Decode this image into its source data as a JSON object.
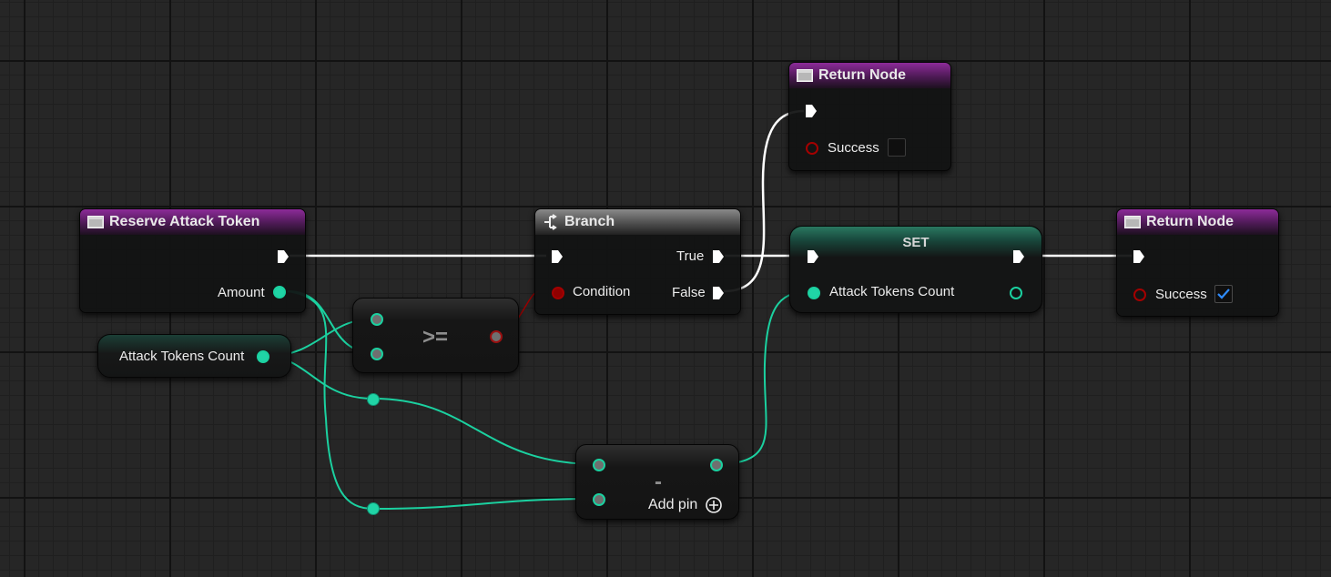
{
  "nodes": {
    "return_top": {
      "title": "Return Node",
      "success_label": "Success",
      "success_checked": false
    },
    "reserve": {
      "title": "Reserve Attack Token",
      "amount_label": "Amount"
    },
    "branch": {
      "title": "Branch",
      "condition_label": "Condition",
      "true_label": "True",
      "false_label": "False"
    },
    "set": {
      "title": "SET",
      "var_label": "Attack Tokens Count"
    },
    "return_right": {
      "title": "Return Node",
      "success_label": "Success",
      "success_checked": true
    },
    "getter": {
      "label": "Attack Tokens Count"
    },
    "compare": {
      "symbol": ">="
    },
    "subtract": {
      "symbol": "-",
      "add_pin_label": "Add pin"
    }
  },
  "colors": {
    "exec_wire": "#ffffff",
    "int_wire": "#1bd1a0",
    "bool_wire": "#9a0000",
    "function_header": "#7b2589",
    "branch_header": "#6a6a6a",
    "set_header": "#23695a"
  },
  "icons": [
    "function-icon",
    "branch-icon",
    "exec-pin-icon",
    "checkbox-checked-icon",
    "add-pin-icon"
  ]
}
